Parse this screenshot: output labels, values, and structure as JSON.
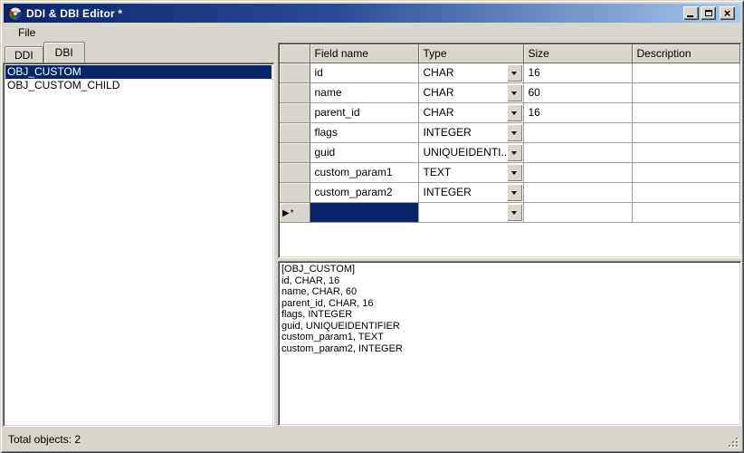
{
  "window": {
    "title": "DDI & DBI Editor *"
  },
  "icons": {
    "app_icon": "color-orb-app-icon",
    "close_glyph": "×"
  },
  "menu": {
    "items": [
      {
        "label": "File"
      }
    ]
  },
  "tabs": [
    {
      "label": "DDI",
      "active": false
    },
    {
      "label": "DBI",
      "active": true
    }
  ],
  "object_list": {
    "items": [
      {
        "label": "OBJ_CUSTOM",
        "selected": true
      },
      {
        "label": "OBJ_CUSTOM_CHILD",
        "selected": false
      }
    ]
  },
  "grid": {
    "columns": {
      "field_name": "Field name",
      "type": "Type",
      "size": "Size",
      "description": "Description"
    },
    "rows": [
      {
        "field_name": "id",
        "type": "CHAR",
        "size": "16",
        "description": ""
      },
      {
        "field_name": "name",
        "type": "CHAR",
        "size": "60",
        "description": ""
      },
      {
        "field_name": "parent_id",
        "type": "CHAR",
        "size": "16",
        "description": ""
      },
      {
        "field_name": "flags",
        "type": "INTEGER",
        "size": "",
        "description": ""
      },
      {
        "field_name": "guid",
        "type": "UNIQUEIDENTI...",
        "size": "",
        "description": ""
      },
      {
        "field_name": "custom_param1",
        "type": "TEXT",
        "size": "",
        "description": ""
      },
      {
        "field_name": "custom_param2",
        "type": "INTEGER",
        "size": "",
        "description": ""
      }
    ],
    "new_row": {
      "marker": "▶*",
      "field_name": "",
      "type": "",
      "size": "",
      "description": ""
    }
  },
  "preview": {
    "lines": [
      "[OBJ_CUSTOM]",
      "id, CHAR, 16",
      "name, CHAR, 60",
      "parent_id, CHAR, 16",
      "flags, INTEGER",
      "guid, UNIQUEIDENTIFIER",
      "custom_param1, TEXT",
      "custom_param2, INTEGER"
    ]
  },
  "status_bar": {
    "text": "Total objects: 2"
  },
  "colors": {
    "title_gradient_start": "#0a246a",
    "title_gradient_end": "#a6caf0",
    "selection": "#0a246a",
    "face": "#d9d6ce"
  }
}
